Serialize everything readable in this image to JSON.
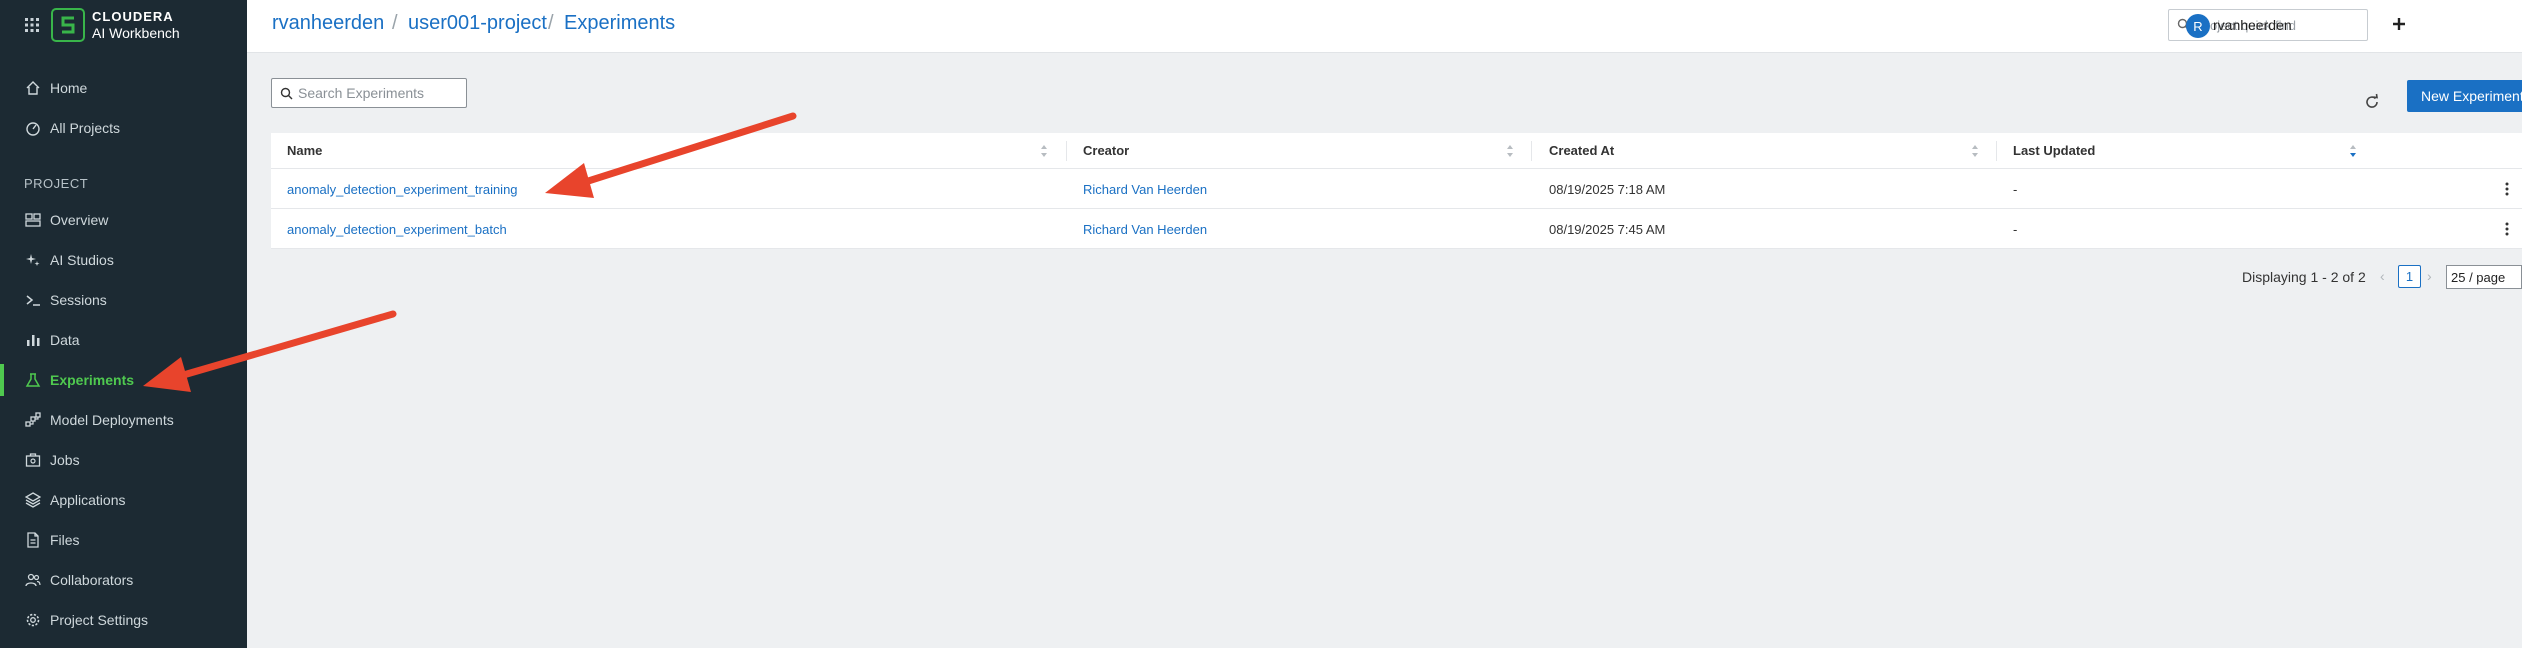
{
  "brand": {
    "name": "CLOUDERA",
    "product": "AI Workbench"
  },
  "sidebar": {
    "top_items": [
      {
        "label": "Home",
        "icon": "home-icon"
      },
      {
        "label": "All Projects",
        "icon": "gauge-icon"
      }
    ],
    "section_label": "PROJECT",
    "project_items": [
      {
        "label": "Overview",
        "icon": "overview-icon"
      },
      {
        "label": "AI Studios",
        "icon": "sparkle-icon"
      },
      {
        "label": "Sessions",
        "icon": "terminal-icon"
      },
      {
        "label": "Data",
        "icon": "bar-chart-icon"
      },
      {
        "label": "Experiments",
        "icon": "flask-icon",
        "active": true
      },
      {
        "label": "Model Deployments",
        "icon": "model-icon"
      },
      {
        "label": "Jobs",
        "icon": "jobs-icon"
      },
      {
        "label": "Applications",
        "icon": "layers-icon"
      },
      {
        "label": "Files",
        "icon": "file-icon"
      },
      {
        "label": "Collaborators",
        "icon": "users-icon"
      },
      {
        "label": "Project Settings",
        "icon": "gear-icon"
      }
    ]
  },
  "header": {
    "breadcrumb": [
      "rvanheerden",
      "user001-project",
      "Experiments"
    ],
    "quick_find_placeholder": "Project quick find",
    "user_initial": "R",
    "user_name": "rvanheerden"
  },
  "main": {
    "search_placeholder": "Search Experiments",
    "new_button": "New Experiment",
    "columns": [
      "Name",
      "Creator",
      "Created At",
      "Last Updated"
    ],
    "rows": [
      {
        "name": "anomaly_detection_experiment_training",
        "creator": "Richard Van Heerden",
        "created_at": "08/19/2025 7:18 AM",
        "last_updated": "-"
      },
      {
        "name": "anomaly_detection_experiment_batch",
        "creator": "Richard Van Heerden",
        "created_at": "08/19/2025 7:45 AM",
        "last_updated": "-"
      }
    ],
    "pagination": {
      "summary": "Displaying 1 - 2 of 2",
      "current_page": "1",
      "page_size": "25 / page"
    }
  },
  "colors": {
    "sidebar_bg": "#1c2a33",
    "accent_green": "#4fc94f",
    "link_blue": "#1a70c4",
    "annotation_arrow": "#e8442c"
  }
}
